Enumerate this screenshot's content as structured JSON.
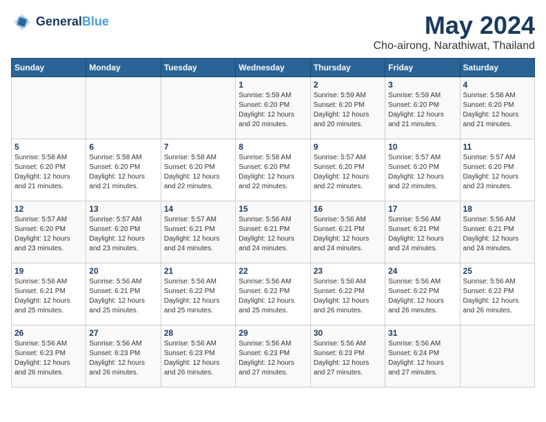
{
  "header": {
    "logo_line1": "General",
    "logo_line2": "Blue",
    "title": "May 2024",
    "subtitle": "Cho-airong, Narathiwat, Thailand"
  },
  "weekdays": [
    "Sunday",
    "Monday",
    "Tuesday",
    "Wednesday",
    "Thursday",
    "Friday",
    "Saturday"
  ],
  "weeks": [
    [
      {
        "day": "",
        "info": ""
      },
      {
        "day": "",
        "info": ""
      },
      {
        "day": "",
        "info": ""
      },
      {
        "day": "1",
        "info": "Sunrise: 5:59 AM\nSunset: 6:20 PM\nDaylight: 12 hours\nand 20 minutes."
      },
      {
        "day": "2",
        "info": "Sunrise: 5:59 AM\nSunset: 6:20 PM\nDaylight: 12 hours\nand 20 minutes."
      },
      {
        "day": "3",
        "info": "Sunrise: 5:59 AM\nSunset: 6:20 PM\nDaylight: 12 hours\nand 21 minutes."
      },
      {
        "day": "4",
        "info": "Sunrise: 5:58 AM\nSunset: 6:20 PM\nDaylight: 12 hours\nand 21 minutes."
      }
    ],
    [
      {
        "day": "5",
        "info": "Sunrise: 5:58 AM\nSunset: 6:20 PM\nDaylight: 12 hours\nand 21 minutes."
      },
      {
        "day": "6",
        "info": "Sunrise: 5:58 AM\nSunset: 6:20 PM\nDaylight: 12 hours\nand 21 minutes."
      },
      {
        "day": "7",
        "info": "Sunrise: 5:58 AM\nSunset: 6:20 PM\nDaylight: 12 hours\nand 22 minutes."
      },
      {
        "day": "8",
        "info": "Sunrise: 5:58 AM\nSunset: 6:20 PM\nDaylight: 12 hours\nand 22 minutes."
      },
      {
        "day": "9",
        "info": "Sunrise: 5:57 AM\nSunset: 6:20 PM\nDaylight: 12 hours\nand 22 minutes."
      },
      {
        "day": "10",
        "info": "Sunrise: 5:57 AM\nSunset: 6:20 PM\nDaylight: 12 hours\nand 22 minutes."
      },
      {
        "day": "11",
        "info": "Sunrise: 5:57 AM\nSunset: 6:20 PM\nDaylight: 12 hours\nand 23 minutes."
      }
    ],
    [
      {
        "day": "12",
        "info": "Sunrise: 5:57 AM\nSunset: 6:20 PM\nDaylight: 12 hours\nand 23 minutes."
      },
      {
        "day": "13",
        "info": "Sunrise: 5:57 AM\nSunset: 6:20 PM\nDaylight: 12 hours\nand 23 minutes."
      },
      {
        "day": "14",
        "info": "Sunrise: 5:57 AM\nSunset: 6:21 PM\nDaylight: 12 hours\nand 24 minutes."
      },
      {
        "day": "15",
        "info": "Sunrise: 5:56 AM\nSunset: 6:21 PM\nDaylight: 12 hours\nand 24 minutes."
      },
      {
        "day": "16",
        "info": "Sunrise: 5:56 AM\nSunset: 6:21 PM\nDaylight: 12 hours\nand 24 minutes."
      },
      {
        "day": "17",
        "info": "Sunrise: 5:56 AM\nSunset: 6:21 PM\nDaylight: 12 hours\nand 24 minutes."
      },
      {
        "day": "18",
        "info": "Sunrise: 5:56 AM\nSunset: 6:21 PM\nDaylight: 12 hours\nand 24 minutes."
      }
    ],
    [
      {
        "day": "19",
        "info": "Sunrise: 5:56 AM\nSunset: 6:21 PM\nDaylight: 12 hours\nand 25 minutes."
      },
      {
        "day": "20",
        "info": "Sunrise: 5:56 AM\nSunset: 6:21 PM\nDaylight: 12 hours\nand 25 minutes."
      },
      {
        "day": "21",
        "info": "Sunrise: 5:56 AM\nSunset: 6:22 PM\nDaylight: 12 hours\nand 25 minutes."
      },
      {
        "day": "22",
        "info": "Sunrise: 5:56 AM\nSunset: 6:22 PM\nDaylight: 12 hours\nand 25 minutes."
      },
      {
        "day": "23",
        "info": "Sunrise: 5:56 AM\nSunset: 6:22 PM\nDaylight: 12 hours\nand 26 minutes."
      },
      {
        "day": "24",
        "info": "Sunrise: 5:56 AM\nSunset: 6:22 PM\nDaylight: 12 hours\nand 26 minutes."
      },
      {
        "day": "25",
        "info": "Sunrise: 5:56 AM\nSunset: 6:22 PM\nDaylight: 12 hours\nand 26 minutes."
      }
    ],
    [
      {
        "day": "26",
        "info": "Sunrise: 5:56 AM\nSunset: 6:23 PM\nDaylight: 12 hours\nand 26 minutes."
      },
      {
        "day": "27",
        "info": "Sunrise: 5:56 AM\nSunset: 6:23 PM\nDaylight: 12 hours\nand 26 minutes."
      },
      {
        "day": "28",
        "info": "Sunrise: 5:56 AM\nSunset: 6:23 PM\nDaylight: 12 hours\nand 26 minutes."
      },
      {
        "day": "29",
        "info": "Sunrise: 5:56 AM\nSunset: 6:23 PM\nDaylight: 12 hours\nand 27 minutes."
      },
      {
        "day": "30",
        "info": "Sunrise: 5:56 AM\nSunset: 6:23 PM\nDaylight: 12 hours\nand 27 minutes."
      },
      {
        "day": "31",
        "info": "Sunrise: 5:56 AM\nSunset: 6:24 PM\nDaylight: 12 hours\nand 27 minutes."
      },
      {
        "day": "",
        "info": ""
      }
    ]
  ]
}
